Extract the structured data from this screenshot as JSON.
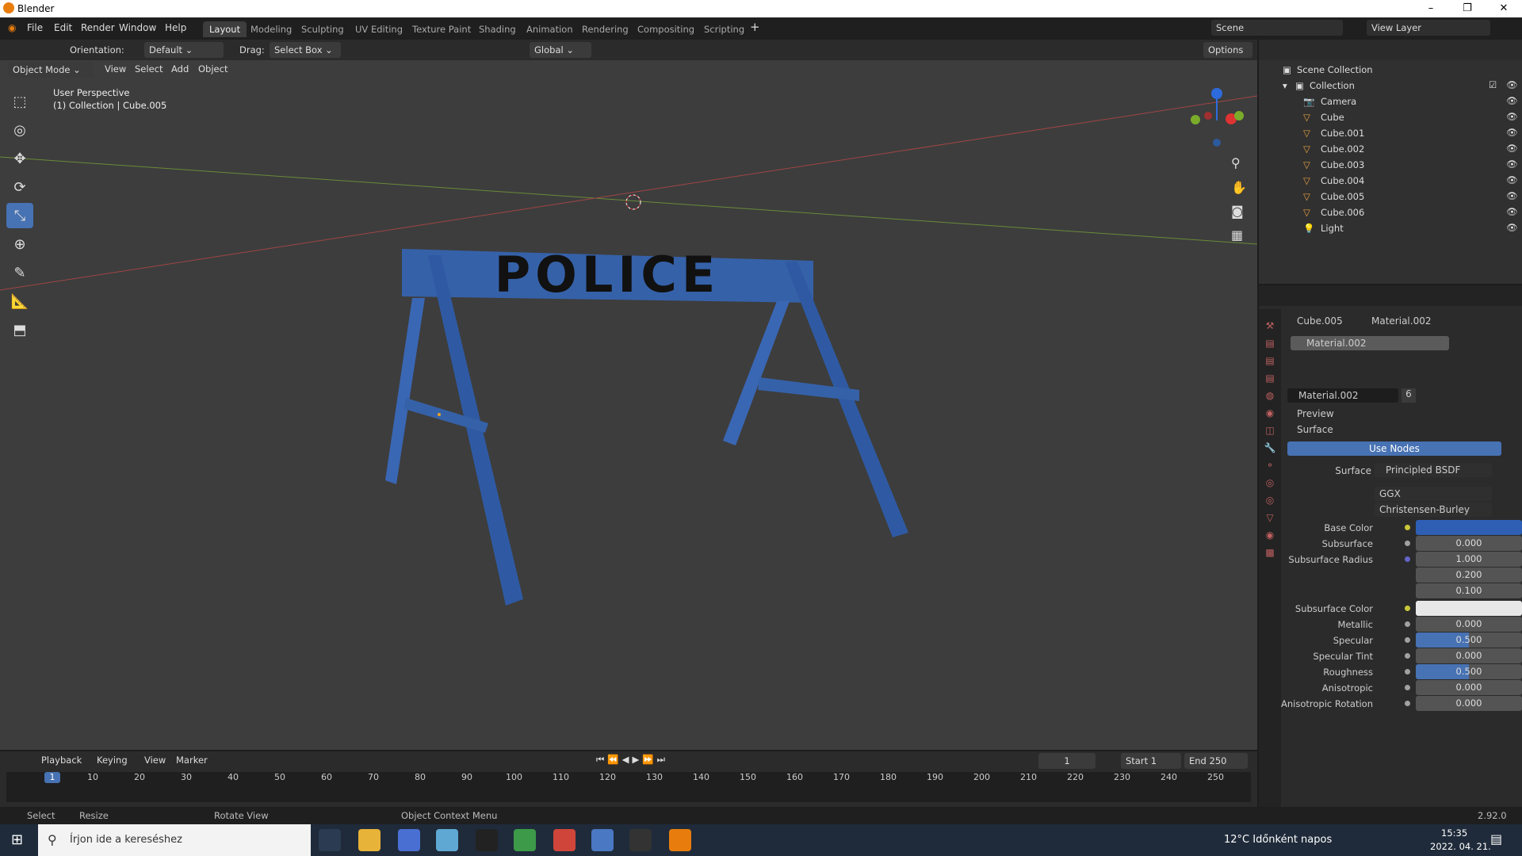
{
  "app": {
    "title": "Blender",
    "version": "2.92.0"
  },
  "menu": [
    "File",
    "Edit",
    "Render",
    "Window",
    "Help"
  ],
  "workspaces": [
    "Layout",
    "Modeling",
    "Sculpting",
    "UV Editing",
    "Texture Paint",
    "Shading",
    "Animation",
    "Rendering",
    "Compositing",
    "Scripting"
  ],
  "scene": {
    "name": "Scene",
    "view_layer": "View Layer"
  },
  "header": {
    "orientation_label": "Orientation:",
    "orientation": "Default",
    "drag_label": "Drag:",
    "drag": "Select Box",
    "transform": "Global",
    "options": "Options"
  },
  "viewport_menu": {
    "mode": "Object Mode",
    "view": "View",
    "select": "Select",
    "add": "Add",
    "object": "Object"
  },
  "overlay_text": {
    "perspective": "User Perspective",
    "context": "(1) Collection | Cube.005"
  },
  "scene_object_text": "POLICE",
  "outliner": {
    "root": "Scene Collection",
    "collection": "Collection",
    "items": [
      "Camera",
      "Cube",
      "Cube.001",
      "Cube.002",
      "Cube.003",
      "Cube.004",
      "Cube.005",
      "Cube.006",
      "Light"
    ]
  },
  "properties": {
    "object": "Cube.005",
    "material": "Material.002",
    "slot": "Material.002",
    "users": "6",
    "preview": "Preview",
    "surface_section": "Surface",
    "use_nodes": "Use Nodes",
    "surface_label": "Surface",
    "surface_value": "Principled BSDF",
    "distribution": "GGX",
    "subsurface_method": "Christensen-Burley",
    "rows": [
      {
        "label": "Base Color",
        "value": ""
      },
      {
        "label": "Subsurface",
        "value": "0.000"
      },
      {
        "label": "Subsurface Radius",
        "value": "1.000"
      },
      {
        "label": "",
        "value": "0.200"
      },
      {
        "label": "",
        "value": "0.100"
      },
      {
        "label": "Subsurface Color",
        "value": ""
      },
      {
        "label": "Metallic",
        "value": "0.000"
      },
      {
        "label": "Specular",
        "value": "0.500"
      },
      {
        "label": "Specular Tint",
        "value": "0.000"
      },
      {
        "label": "Roughness",
        "value": "0.500"
      },
      {
        "label": "Anisotropic",
        "value": "0.000"
      },
      {
        "label": "Anisotropic Rotation",
        "value": "0.000"
      }
    ]
  },
  "timeline": {
    "playback": "Playback",
    "keying": "Keying",
    "view": "View",
    "marker": "Marker",
    "current": "1",
    "start_label": "Start",
    "start": "1",
    "end_label": "End",
    "end": "250",
    "ticks": [
      "1",
      "10",
      "20",
      "30",
      "40",
      "50",
      "60",
      "70",
      "80",
      "90",
      "100",
      "110",
      "120",
      "130",
      "140",
      "150",
      "160",
      "170",
      "180",
      "190",
      "200",
      "210",
      "220",
      "230",
      "240",
      "250"
    ]
  },
  "status": {
    "select": "Select",
    "resize": "Resize",
    "rotate": "Rotate View",
    "context": "Object Context Menu"
  },
  "taskbar": {
    "search": "Írjon ide a kereséshez",
    "weather": "12°C  Időnként napos",
    "time": "15:35",
    "date": "2022. 04. 21."
  }
}
